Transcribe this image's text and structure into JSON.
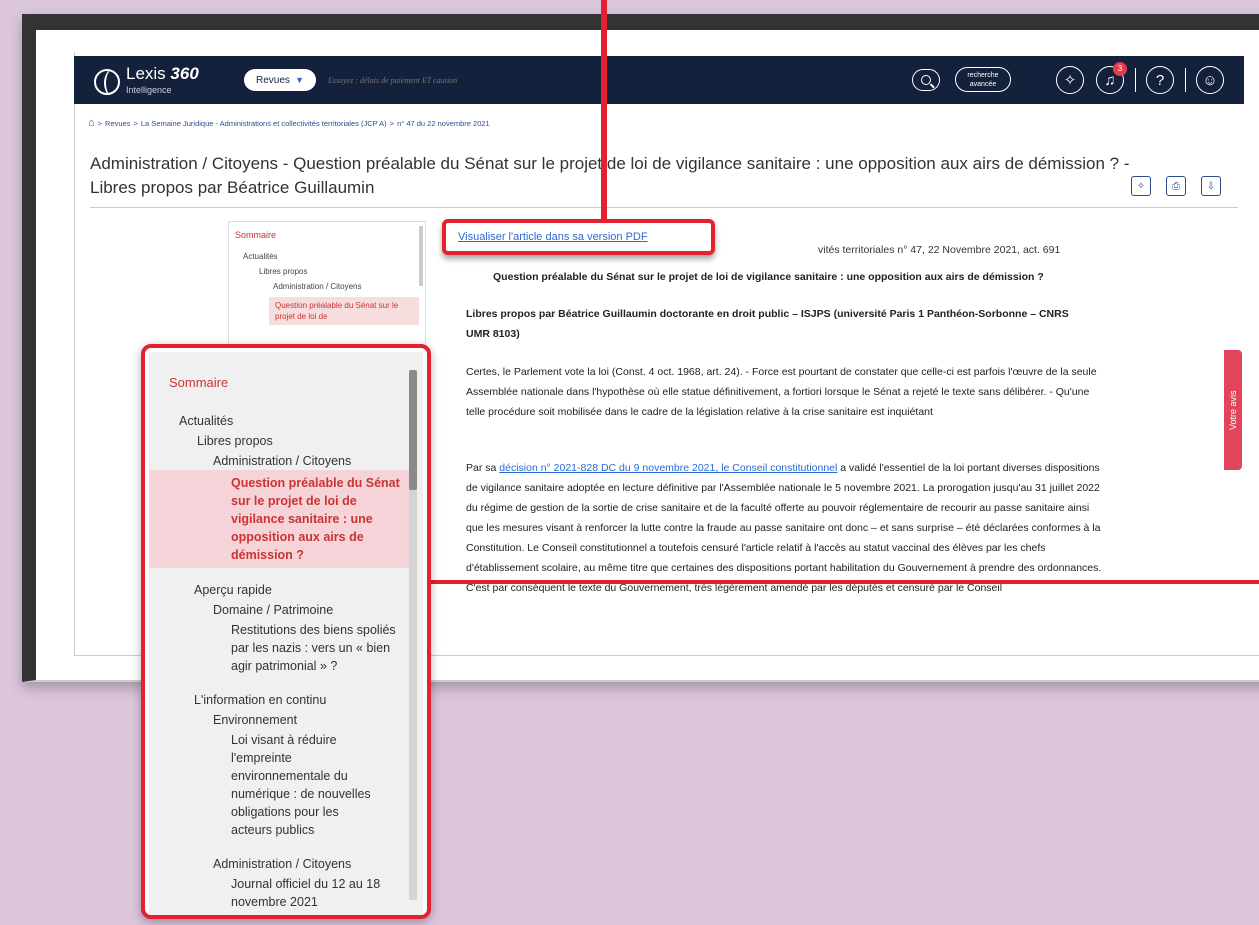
{
  "app": {
    "logo_main": "Lexis ",
    "logo_num": "360",
    "logo_sub": "Intelligence"
  },
  "search": {
    "scope": "Revues",
    "placeholder": "Essayez : délais de paiement ET caution",
    "advanced_line1": "recherche",
    "advanced_line2": "avancée"
  },
  "notifications": {
    "count": "3"
  },
  "breadcrumb": [
    "Revues",
    "La Semaine Juridique - Administrations et collectivités territoriales (JCP A)",
    "n° 47 du 22 novembre 2021"
  ],
  "page": {
    "title": "Administration / Citoyens - Question préalable du Sénat sur le projet de loi de vigilance sanitaire : une opposition aux airs de démission ? - Libres propos par Béatrice Guillaumin"
  },
  "mini_toc": {
    "heading": "Sommaire",
    "l1": "Actualités",
    "l2": "Libres propos",
    "l3": "Administration / Citoyens",
    "selected": "Question préalable du Sénat sur le projet de loi de"
  },
  "article": {
    "pdf_link": "Visualiser l'article dans sa version PDF",
    "source_tail": "vités territoriales n° 47, 22 Novembre 2021, act. 691",
    "title": "Question préalable du Sénat sur le projet de loi de vigilance sanitaire : une opposition aux airs de démission ?",
    "author": "Libres propos par Béatrice Guillaumin doctorante en droit public – ISJPS (université Paris 1 Panthéon-Sorbonne – CNRS UMR 8103)",
    "p1": "Certes, le Parlement vote la loi (Const. 4 oct. 1968, art. 24). - Force est pourtant de constater que celle-ci est parfois l'œuvre de la seule Assemblée nationale dans l'hypothèse où elle statue définitivement, a fortiori lorsque le Sénat a rejeté le texte sans délibérer. - Qu'une telle procédure soit mobilisée dans le cadre de la législation relative à la crise sanitaire est inquiétant",
    "p2_prefix": "Par sa ",
    "p2_link": "décision n° 2021-828 DC du 9 novembre 2021, le Conseil constitutionnel",
    "p2_rest": " a validé l'essentiel de la loi portant diverses dispositions de vigilance sanitaire adoptée en lecture définitive par l'Assemblée nationale le 5 novembre 2021. La prorogation jusqu'au 31 juillet 2022 du régime de gestion de la sortie de crise sanitaire et de la faculté offerte au pouvoir réglementaire de recourir au passe sanitaire ainsi que les mesures visant à renforcer la lutte contre la fraude au passe sanitaire ont donc – et sans surprise – été déclarées conformes à la Constitution. Le Conseil constitutionnel a toutefois censuré l'article relatif à l'accès au statut vaccinal des élèves par les chefs d'établissement scolaire, au même titre que certaines des dispositions portant habilitation du Gouvernement à prendre des ordonnances. C'est par conséquent le texte du Gouvernement, très légèrement amendé par les députés et censuré par le Conseil"
  },
  "feedback": {
    "label": "Votre avis"
  },
  "toc": {
    "heading": "Sommaire",
    "items": [
      {
        "text": "Actualités"
      },
      {
        "text": "Libres propos"
      },
      {
        "text": "Administration / Citoyens"
      },
      {
        "text": "Question préalable du Sénat sur le projet de loi de vigilance sanitaire : une opposition aux airs de démission ?"
      },
      {
        "text": "Aperçu rapide"
      },
      {
        "text": "Domaine / Patrimoine"
      },
      {
        "text": "Restitutions des biens spoliés par les nazis : vers un « bien agir patrimonial » ?"
      },
      {
        "text": "L'information en continu"
      },
      {
        "text": "Environnement"
      },
      {
        "text": "Loi visant à réduire l'empreinte environnementale du numérique : de nouvelles obligations pour les acteurs publics"
      },
      {
        "text": "Administration / Citoyens"
      },
      {
        "text": "Journal officiel du 12 au 18 novembre 2021"
      }
    ]
  },
  "colors": {
    "accent": "#e5202f",
    "navbar": "#14213d",
    "toc_heading": "#cc3333",
    "background": "#dcc6dc"
  }
}
